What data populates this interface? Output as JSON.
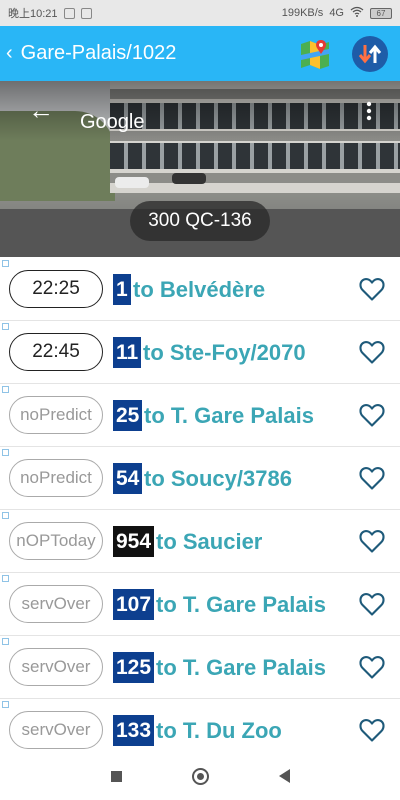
{
  "status_bar": {
    "time": "晚上10:21",
    "network_speed": "199KB/s",
    "network_type": "4G",
    "battery": "67"
  },
  "app_bar": {
    "back_glyph": "‹",
    "title": "Gare-Palais/1022",
    "map_icon": "map-icon",
    "sort_icon": "sort-arrows-icon"
  },
  "street_view": {
    "back_glyph": "←",
    "brand": "Google",
    "menu_glyph": "⋮",
    "address": "300 QC-136"
  },
  "arrivals": [
    {
      "time": "22:25",
      "status": "live",
      "route": "1",
      "route_color": "#0d3f8f",
      "destination": "to Belvédère"
    },
    {
      "time": "22:45",
      "status": "live",
      "route": "11",
      "route_color": "#0d3f8f",
      "destination": "to Ste-Foy/2070"
    },
    {
      "time": "noPredict",
      "status": "muted",
      "route": "25",
      "route_color": "#0d3f8f",
      "destination": "to T. Gare Palais"
    },
    {
      "time": "noPredict",
      "status": "muted",
      "route": "54",
      "route_color": "#0d3f8f",
      "destination": "to Soucy/3786"
    },
    {
      "time": "nOPToday",
      "status": "muted",
      "route": "954",
      "route_color": "#111111",
      "destination": "to Saucier"
    },
    {
      "time": "servOver",
      "status": "muted",
      "route": "107",
      "route_color": "#0d3f8f",
      "destination": "to T. Gare Palais"
    },
    {
      "time": "servOver",
      "status": "muted",
      "route": "125",
      "route_color": "#0d3f8f",
      "destination": "to T. Gare Palais"
    },
    {
      "time": "servOver",
      "status": "muted",
      "route": "133",
      "route_color": "#0d3f8f",
      "destination": "to T. Du Zoo"
    }
  ],
  "colors": {
    "accent": "#29b6f6",
    "destination_text": "#3ba6b5",
    "heart_outline": "#1e5a7a"
  }
}
